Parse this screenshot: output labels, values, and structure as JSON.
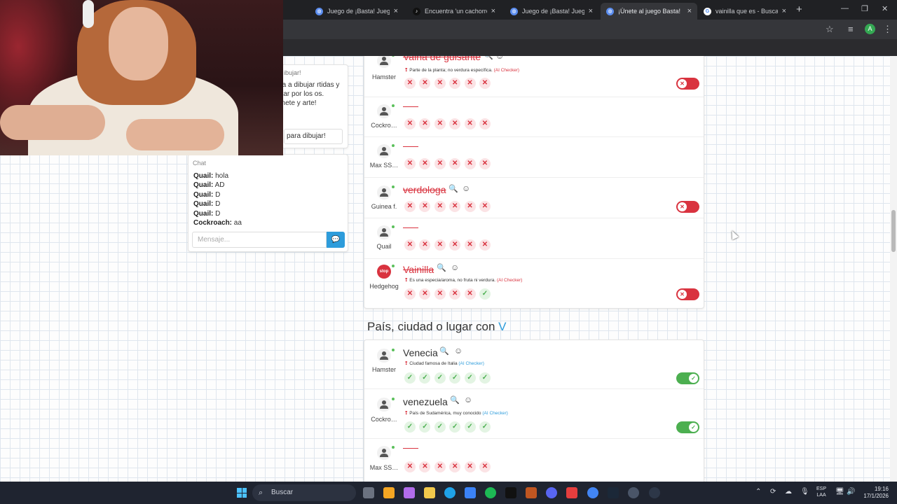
{
  "browser": {
    "tabs": [
      {
        "label": "Juego de ¡Basta! Juega Stu",
        "favicon": "basta"
      },
      {
        "label": "Encuentra 'un cachorro fe",
        "favicon": "tiktok"
      },
      {
        "label": "Juego de ¡Basta! Juega Stu",
        "favicon": "basta"
      },
      {
        "label": "¡Únete al juego Basta!",
        "favicon": "basta"
      },
      {
        "label": "vainilla que es - Buscar co",
        "favicon": "google"
      }
    ],
    "close_glyph": "×",
    "new_tab_glyph": "+",
    "profile_initial": "A"
  },
  "sidebar": {
    "invite_title": "ibujar!",
    "invite_desc": "reta a dibujar rtidas y votar por los os. ¡Únete y arte!",
    "draw_button": "para dibujar!"
  },
  "chat": {
    "title": "Chat",
    "messages": [
      {
        "user": "Quail:",
        "text": "hola"
      },
      {
        "user": "Quail:",
        "text": "AD"
      },
      {
        "user": "Quail:",
        "text": "D"
      },
      {
        "user": "Quail:",
        "text": "D"
      },
      {
        "user": "Quail:",
        "text": "D"
      },
      {
        "user": "Cockroach:",
        "text": "aa"
      }
    ],
    "placeholder": "Mensaje..."
  },
  "category1": {
    "rows": [
      {
        "user": "Hamster",
        "word": "Vaina de guisante",
        "note": "Parte de la planta; no verdura específica.",
        "ai": "(AI Checker)",
        "votes": [
          "x",
          "x",
          "x",
          "x",
          "x",
          "x"
        ],
        "toggle": "off"
      },
      {
        "user": "Cockro…",
        "word": "",
        "votes": [
          "x",
          "x",
          "x",
          "x",
          "x",
          "x"
        ]
      },
      {
        "user": "Max SS…",
        "word": "",
        "votes": [
          "x",
          "x",
          "x",
          "x",
          "x",
          "x"
        ]
      },
      {
        "user": "Guinea f.",
        "word": "verdologa",
        "votes": [
          "x",
          "x",
          "x",
          "x",
          "x",
          "x"
        ],
        "toggle": "off"
      },
      {
        "user": "Quail",
        "word": "",
        "votes": [
          "x",
          "x",
          "x",
          "x",
          "x",
          "x"
        ]
      },
      {
        "user": "Hedgehog",
        "word": "Vainilla",
        "note": "Es una especia/aroma, no fruta ni verdura.",
        "ai": "(AI Checker)",
        "votes": [
          "x",
          "x",
          "x",
          "x",
          "x",
          "ok"
        ],
        "toggle": "off",
        "stop": "stop"
      }
    ]
  },
  "category2": {
    "title": "País, ciudad o lugar con",
    "letter": "V",
    "rows": [
      {
        "user": "Hamster",
        "word": "Venecia",
        "note": "Ciudad famosa de Italia",
        "ai": "(AI Checker)",
        "votes": [
          "ok",
          "ok",
          "ok",
          "ok",
          "ok",
          "ok"
        ],
        "toggle": "on"
      },
      {
        "user": "Cockro…",
        "word": "venezuela",
        "note": "País de Sudamérica, muy conocido",
        "ai": "(AI Checker)",
        "votes": [
          "ok",
          "ok",
          "ok",
          "ok",
          "ok",
          "ok"
        ],
        "toggle": "on"
      },
      {
        "user": "Max SS…",
        "word": "",
        "votes": [
          "x",
          "x",
          "x",
          "x",
          "x",
          "x"
        ]
      }
    ]
  },
  "taskbar": {
    "search_label": "Buscar",
    "lang_top": "ESP",
    "lang_bottom": "LAA",
    "time": "19:16",
    "date": "17/1/2026"
  },
  "colors": {
    "accent": "#2d9cdb",
    "reject": "#d9333f",
    "accept": "#4caf50"
  }
}
